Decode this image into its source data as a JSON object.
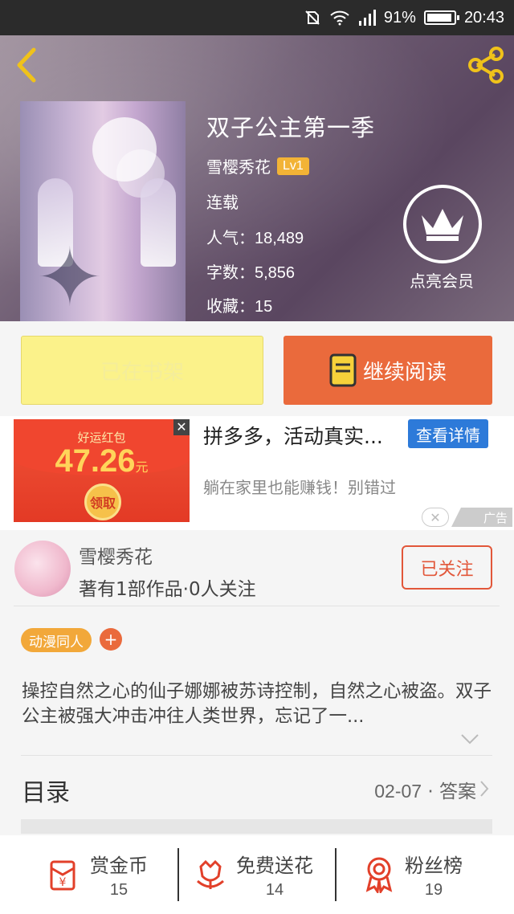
{
  "status_bar": {
    "battery": "91%",
    "time": "20:43"
  },
  "book": {
    "title": "双子公主第一季",
    "author": "雪樱秀花",
    "level": "Lv1",
    "status": "连载",
    "popularity_label": "人气：",
    "popularity": "18,489",
    "words_label": "字数：",
    "words": "5,856",
    "favorites_label": "收藏：",
    "favorites": "15",
    "vip_label": "点亮会员"
  },
  "actions": {
    "shelf": "已在书架",
    "read": "继续阅读"
  },
  "ad": {
    "image_small": "好运红包",
    "image_amount": "47.26",
    "image_unit": "元",
    "image_claim": "领取",
    "title": "拼多多，活动真实...",
    "button": "查看详情",
    "description": "躺在家里也能赚钱！别错过",
    "tag": "广告"
  },
  "author_card": {
    "name": "雪樱秀花",
    "info": "著有1部作品·0人关注",
    "follow": "已关注"
  },
  "tag": "动漫同人",
  "synopsis": "操控自然之心的仙子娜娜被苏诗控制，自然之心被盗。双子公主被强大冲击冲往人类世界，忘记了一...",
  "toc": {
    "label": "目录",
    "date": "02-07",
    "sep": " · ",
    "latest": "答案"
  },
  "bottom": [
    {
      "label": "赏金币",
      "value": "15",
      "icon": "red-envelope-icon"
    },
    {
      "label": "免费送花",
      "value": "14",
      "icon": "flower-icon"
    },
    {
      "label": "粉丝榜",
      "value": "19",
      "icon": "medal-icon"
    }
  ],
  "colors": {
    "accent": "#ea6a3c",
    "shelf": "#fbf28a",
    "ad_button": "#2d7ad9",
    "tag": "#f2a83a"
  }
}
